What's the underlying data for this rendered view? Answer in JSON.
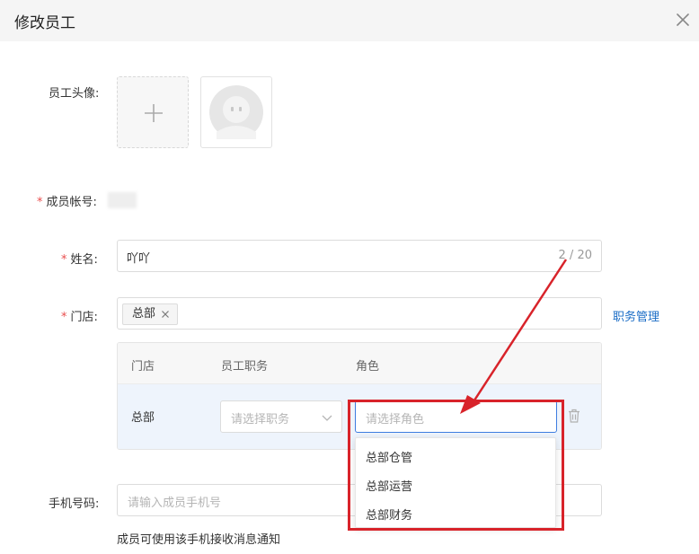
{
  "dialog": {
    "title": "修改员工"
  },
  "avatar": {
    "label": "员工头像:"
  },
  "account": {
    "label": "成员帐号:"
  },
  "name": {
    "label": "姓名:",
    "value": "吖吖",
    "counter": "2 / 20"
  },
  "store": {
    "label": "门店:",
    "tag": "总部",
    "link": "职务管理",
    "table": {
      "headers": [
        "门店",
        "员工职务",
        "角色"
      ],
      "row": {
        "store": "总部",
        "position_placeholder": "请选择职务",
        "role_placeholder": "请选择角色"
      }
    }
  },
  "role_dropdown": {
    "options": [
      "总部仓管",
      "总部运营",
      "总部财务"
    ]
  },
  "phone": {
    "label": "手机号码:",
    "placeholder": "请输入成员手机号",
    "hint": "成员可使用该手机接收消息通知"
  },
  "colors": {
    "required": "#e94d4d",
    "link": "#1a6cc6",
    "annotation": "#d8232a",
    "focus": "#3d7de0"
  },
  "icons": [
    "close-icon",
    "plus-icon",
    "avatar-placeholder-icon",
    "tag-close-icon",
    "chevron-down-icon",
    "trash-icon"
  ]
}
